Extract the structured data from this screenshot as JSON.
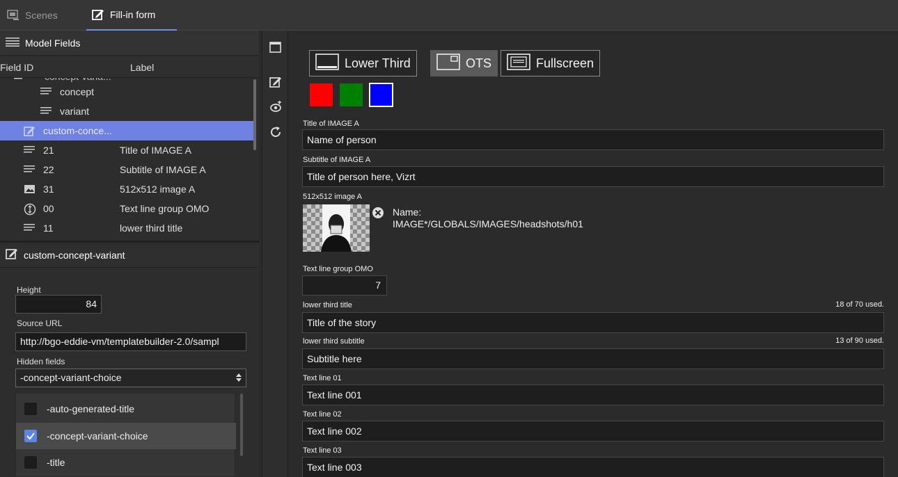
{
  "tabs": [
    {
      "label": "Scenes",
      "icon": "scenes-icon"
    },
    {
      "label": "Fill-in form",
      "icon": "edit-form-icon"
    }
  ],
  "model_fields": {
    "title": "Model Fields",
    "columns": {
      "field_id": "Field ID",
      "label": "Label"
    },
    "rows": [
      {
        "id": "concept-varia...",
        "label": ""
      },
      {
        "id": "concept",
        "label": ""
      },
      {
        "id": "variant",
        "label": ""
      },
      {
        "id": "custom-conce...",
        "label": ""
      },
      {
        "id": "21",
        "label": "Title of IMAGE A"
      },
      {
        "id": "22",
        "label": "Subtitle of IMAGE A"
      },
      {
        "id": "31",
        "label": "512x512 image A"
      },
      {
        "id": "00",
        "label": "Text line group OMO"
      },
      {
        "id": "11",
        "label": "lower third title"
      }
    ]
  },
  "properties": {
    "title": "custom-concept-variant",
    "height_label": "Height",
    "height_value": "84",
    "source_label": "Source URL",
    "source_value": "http://bgo-eddie-vm/templatebuilder-2.0/sampl",
    "hidden_label": "Hidden fields",
    "hidden_selected": "-concept-variant-choice",
    "hidden_options": [
      {
        "label": "-auto-generated-title",
        "checked": false
      },
      {
        "label": "-concept-variant-choice",
        "checked": true
      },
      {
        "label": "-title",
        "checked": false
      }
    ]
  },
  "form": {
    "variants": [
      {
        "label": "Lower Third",
        "active": false
      },
      {
        "label": "OTS",
        "active": true
      },
      {
        "label": "Fullscreen",
        "active": false
      }
    ],
    "colors": [
      "#ff0000",
      "#008000",
      "#0000ff"
    ],
    "title_a": {
      "label": "Title of IMAGE A",
      "value": "Name of person"
    },
    "subtitle_a": {
      "label": "Subtitle of IMAGE A",
      "value": "Title of person here, Vizrt"
    },
    "image_a": {
      "label": "512x512 image A",
      "name_label": "Name:",
      "path": "IMAGE*/GLOBALS/IMAGES/headshots/h01"
    },
    "omo": {
      "label": "Text line group OMO",
      "value": "7"
    },
    "lt_title": {
      "label": "lower third title",
      "value": "Title of the story",
      "count": "18 of 70 used."
    },
    "lt_subtitle": {
      "label": "lower third subtitle",
      "value": "Subtitle here",
      "count": "13 of 90 used."
    },
    "line01": {
      "label": "Text line 01",
      "value": "Text line 001"
    },
    "line02": {
      "label": "Text line 02",
      "value": "Text line 002"
    },
    "line03": {
      "label": "Text line 03",
      "value": "Text line 003"
    }
  }
}
